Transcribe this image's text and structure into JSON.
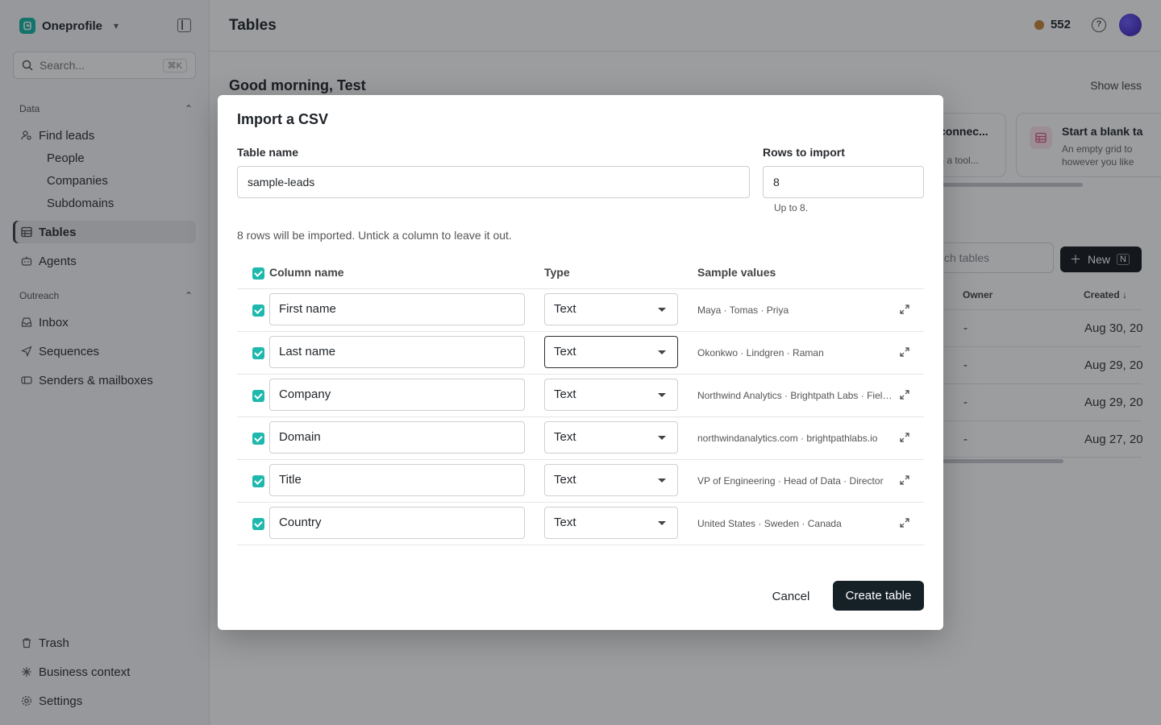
{
  "workspace": {
    "name": "Oneprofile"
  },
  "search": {
    "placeholder": "Search...",
    "shortcut": "⌘K"
  },
  "sidebar": {
    "data_section": "Data",
    "find_leads": "Find leads",
    "people": "People",
    "companies": "Companies",
    "subdomains": "Subdomains",
    "tables": "Tables",
    "agents": "Agents",
    "outreach_section": "Outreach",
    "inbox": "Inbox",
    "sequences": "Sequences",
    "senders": "Senders & mailboxes",
    "trash": "Trash",
    "business_context": "Business context",
    "settings": "Settings"
  },
  "header": {
    "title": "Tables",
    "credits": "552"
  },
  "background": {
    "greeting": "Good morning, Test",
    "show_less": "Show less",
    "card_connect_title": "connec...",
    "card_connect_desc": "m a tool...",
    "card_blank_title": "Start a blank ta",
    "card_blank_desc_1": "An empty grid to",
    "card_blank_desc_2": "however you like",
    "search_placeholder": "ch tables",
    "new_label": "New",
    "new_shortcut": "N",
    "col_owner": "Owner",
    "col_created": "Created",
    "rows": [
      {
        "owner": "-",
        "created": "Aug 30, 20"
      },
      {
        "owner": "-",
        "created": "Aug 29, 20"
      },
      {
        "owner": "-",
        "created": "Aug 29, 20"
      },
      {
        "owner": "-",
        "created": "Aug 27, 20"
      }
    ]
  },
  "modal": {
    "title": "Import a CSV",
    "table_name_label": "Table name",
    "table_name_value": "sample-leads",
    "rows_label": "Rows to import",
    "rows_value": "8",
    "rows_hint": "Up to 8.",
    "info": "8 rows will be imported. Untick a column to leave it out.",
    "col_name_header": "Column name",
    "col_type_header": "Type",
    "col_sample_header": "Sample values",
    "columns": [
      {
        "name": "First name",
        "type": "Text",
        "sample": "Maya · Tomas · Priya"
      },
      {
        "name": "Last name",
        "type": "Text",
        "sample": "Okonkwo · Lindgren · Raman"
      },
      {
        "name": "Company",
        "type": "Text",
        "sample": "Northwind Analytics · Brightpath Labs · Fieldstone"
      },
      {
        "name": "Domain",
        "type": "Text",
        "sample": "northwindanalytics.com · brightpathlabs.io"
      },
      {
        "name": "Title",
        "type": "Text",
        "sample": "VP of Engineering · Head of Data · Director"
      },
      {
        "name": "Country",
        "type": "Text",
        "sample": "United States · Sweden · Canada"
      }
    ],
    "cancel": "Cancel",
    "create": "Create table"
  },
  "colors": {
    "accent": "#1fb8ad",
    "primary_button": "#152126",
    "brand": "#14b8a6"
  }
}
